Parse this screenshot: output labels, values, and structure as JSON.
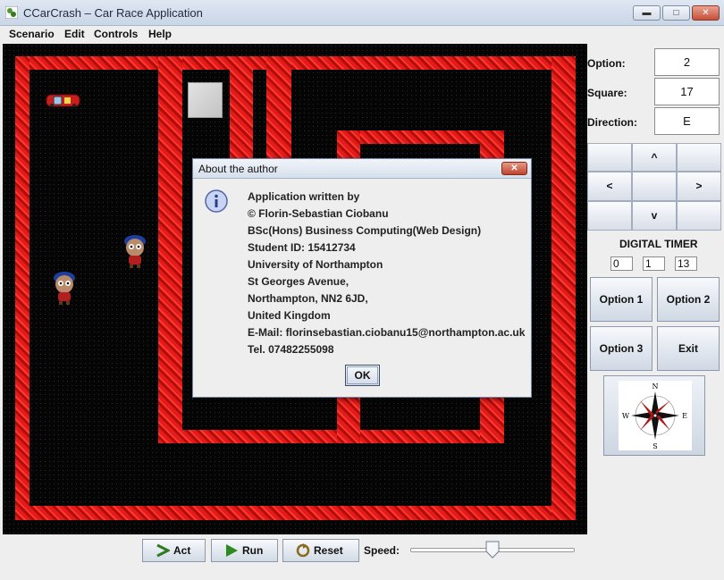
{
  "window": {
    "title": "CCarCrash – Car Race Application",
    "controls": [
      "minimize",
      "maximize",
      "close"
    ]
  },
  "menu": [
    "Scenario",
    "Edit",
    "Controls",
    "Help"
  ],
  "panel": {
    "option_label": "Option:",
    "option_value": "2",
    "square_label": "Square:",
    "square_value": "17",
    "direction_label": "Direction:",
    "direction_value": "E",
    "arrows": {
      "up": "^",
      "left": "<",
      "right": ">",
      "down": "v"
    },
    "timer_title": "DIGITAL TIMER",
    "timer": [
      "0",
      "1",
      "13"
    ],
    "option1": "Option 1",
    "option2": "Option 2",
    "option3": "Option 3",
    "exit": "Exit",
    "compass_letters": {
      "n": "N",
      "s": "S",
      "e": "E",
      "w": "W"
    }
  },
  "bottom": {
    "act": "Act",
    "run": "Run",
    "reset": "Reset",
    "speed_label": "Speed:",
    "speed_level": 0.5
  },
  "dialog": {
    "title": "About the author",
    "lines": [
      "Application written by",
      "© Florin-Sebastian Ciobanu",
      "BSc(Hons) Business Computing(Web Design)",
      "Student ID: 15412734",
      "University of Northampton",
      "St Georges Avenue,",
      "Northampton, NN2 6JD,",
      "United Kingdom",
      "E-Mail: florinsebastian.ciobanu15@northampton.ac.uk",
      "Tel. 07482255098"
    ],
    "ok": "OK"
  },
  "colors": {
    "wall": "#e31b1b",
    "background": "#050505",
    "accent": "#6e86a6"
  }
}
